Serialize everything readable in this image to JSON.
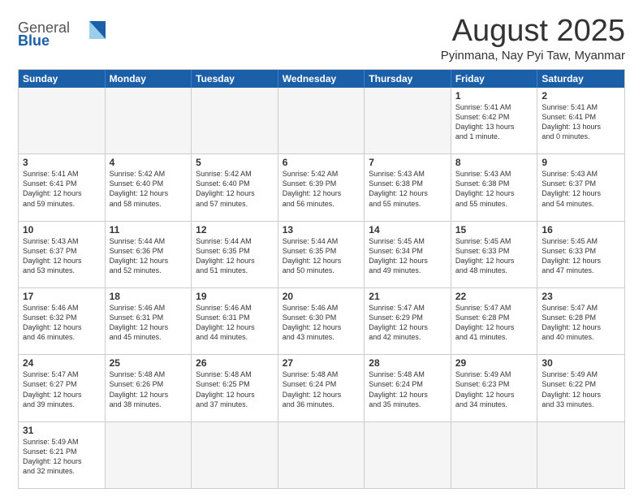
{
  "header": {
    "logo_general": "General",
    "logo_blue": "Blue",
    "month_title": "August 2025",
    "location": "Pyinmana, Nay Pyi Taw, Myanmar"
  },
  "weekdays": [
    "Sunday",
    "Monday",
    "Tuesday",
    "Wednesday",
    "Thursday",
    "Friday",
    "Saturday"
  ],
  "weeks": [
    [
      {
        "day": "",
        "info": ""
      },
      {
        "day": "",
        "info": ""
      },
      {
        "day": "",
        "info": ""
      },
      {
        "day": "",
        "info": ""
      },
      {
        "day": "",
        "info": ""
      },
      {
        "day": "1",
        "info": "Sunrise: 5:41 AM\nSunset: 6:42 PM\nDaylight: 13 hours\nand 1 minute."
      },
      {
        "day": "2",
        "info": "Sunrise: 5:41 AM\nSunset: 6:41 PM\nDaylight: 13 hours\nand 0 minutes."
      }
    ],
    [
      {
        "day": "3",
        "info": "Sunrise: 5:41 AM\nSunset: 6:41 PM\nDaylight: 12 hours\nand 59 minutes."
      },
      {
        "day": "4",
        "info": "Sunrise: 5:42 AM\nSunset: 6:40 PM\nDaylight: 12 hours\nand 58 minutes."
      },
      {
        "day": "5",
        "info": "Sunrise: 5:42 AM\nSunset: 6:40 PM\nDaylight: 12 hours\nand 57 minutes."
      },
      {
        "day": "6",
        "info": "Sunrise: 5:42 AM\nSunset: 6:39 PM\nDaylight: 12 hours\nand 56 minutes."
      },
      {
        "day": "7",
        "info": "Sunrise: 5:43 AM\nSunset: 6:38 PM\nDaylight: 12 hours\nand 55 minutes."
      },
      {
        "day": "8",
        "info": "Sunrise: 5:43 AM\nSunset: 6:38 PM\nDaylight: 12 hours\nand 55 minutes."
      },
      {
        "day": "9",
        "info": "Sunrise: 5:43 AM\nSunset: 6:37 PM\nDaylight: 12 hours\nand 54 minutes."
      }
    ],
    [
      {
        "day": "10",
        "info": "Sunrise: 5:43 AM\nSunset: 6:37 PM\nDaylight: 12 hours\nand 53 minutes."
      },
      {
        "day": "11",
        "info": "Sunrise: 5:44 AM\nSunset: 6:36 PM\nDaylight: 12 hours\nand 52 minutes."
      },
      {
        "day": "12",
        "info": "Sunrise: 5:44 AM\nSunset: 6:35 PM\nDaylight: 12 hours\nand 51 minutes."
      },
      {
        "day": "13",
        "info": "Sunrise: 5:44 AM\nSunset: 6:35 PM\nDaylight: 12 hours\nand 50 minutes."
      },
      {
        "day": "14",
        "info": "Sunrise: 5:45 AM\nSunset: 6:34 PM\nDaylight: 12 hours\nand 49 minutes."
      },
      {
        "day": "15",
        "info": "Sunrise: 5:45 AM\nSunset: 6:33 PM\nDaylight: 12 hours\nand 48 minutes."
      },
      {
        "day": "16",
        "info": "Sunrise: 5:45 AM\nSunset: 6:33 PM\nDaylight: 12 hours\nand 47 minutes."
      }
    ],
    [
      {
        "day": "17",
        "info": "Sunrise: 5:46 AM\nSunset: 6:32 PM\nDaylight: 12 hours\nand 46 minutes."
      },
      {
        "day": "18",
        "info": "Sunrise: 5:46 AM\nSunset: 6:31 PM\nDaylight: 12 hours\nand 45 minutes."
      },
      {
        "day": "19",
        "info": "Sunrise: 5:46 AM\nSunset: 6:31 PM\nDaylight: 12 hours\nand 44 minutes."
      },
      {
        "day": "20",
        "info": "Sunrise: 5:46 AM\nSunset: 6:30 PM\nDaylight: 12 hours\nand 43 minutes."
      },
      {
        "day": "21",
        "info": "Sunrise: 5:47 AM\nSunset: 6:29 PM\nDaylight: 12 hours\nand 42 minutes."
      },
      {
        "day": "22",
        "info": "Sunrise: 5:47 AM\nSunset: 6:28 PM\nDaylight: 12 hours\nand 41 minutes."
      },
      {
        "day": "23",
        "info": "Sunrise: 5:47 AM\nSunset: 6:28 PM\nDaylight: 12 hours\nand 40 minutes."
      }
    ],
    [
      {
        "day": "24",
        "info": "Sunrise: 5:47 AM\nSunset: 6:27 PM\nDaylight: 12 hours\nand 39 minutes."
      },
      {
        "day": "25",
        "info": "Sunrise: 5:48 AM\nSunset: 6:26 PM\nDaylight: 12 hours\nand 38 minutes."
      },
      {
        "day": "26",
        "info": "Sunrise: 5:48 AM\nSunset: 6:25 PM\nDaylight: 12 hours\nand 37 minutes."
      },
      {
        "day": "27",
        "info": "Sunrise: 5:48 AM\nSunset: 6:24 PM\nDaylight: 12 hours\nand 36 minutes."
      },
      {
        "day": "28",
        "info": "Sunrise: 5:48 AM\nSunset: 6:24 PM\nDaylight: 12 hours\nand 35 minutes."
      },
      {
        "day": "29",
        "info": "Sunrise: 5:49 AM\nSunset: 6:23 PM\nDaylight: 12 hours\nand 34 minutes."
      },
      {
        "day": "30",
        "info": "Sunrise: 5:49 AM\nSunset: 6:22 PM\nDaylight: 12 hours\nand 33 minutes."
      }
    ],
    [
      {
        "day": "31",
        "info": "Sunrise: 5:49 AM\nSunset: 6:21 PM\nDaylight: 12 hours\nand 32 minutes."
      },
      {
        "day": "",
        "info": ""
      },
      {
        "day": "",
        "info": ""
      },
      {
        "day": "",
        "info": ""
      },
      {
        "day": "",
        "info": ""
      },
      {
        "day": "",
        "info": ""
      },
      {
        "day": "",
        "info": ""
      }
    ]
  ]
}
